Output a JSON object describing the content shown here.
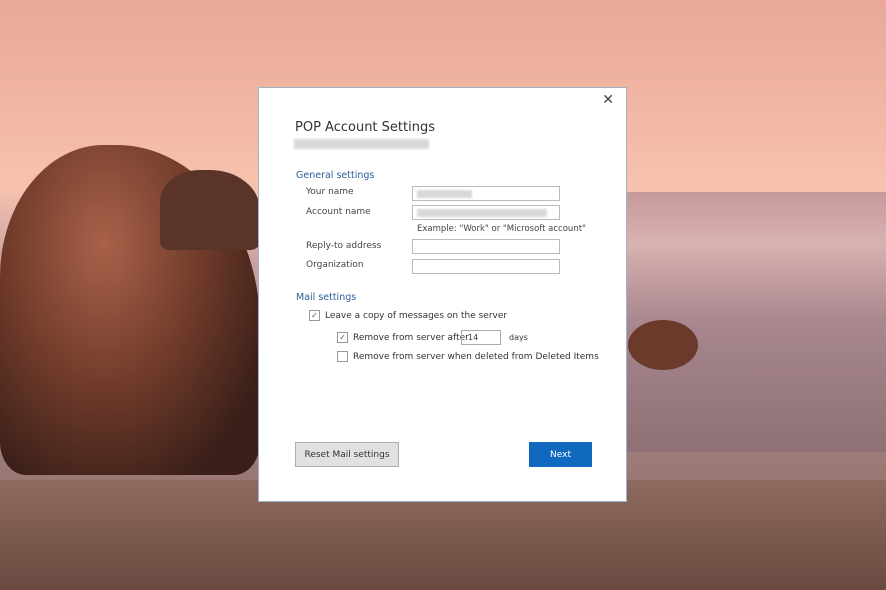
{
  "dialog": {
    "title": "POP Account Settings",
    "close": "✕",
    "general_settings": "General settings",
    "your_name_label": "Your name",
    "account_name_label": "Account name",
    "account_hint": "Example: \"Work\" or \"Microsoft account\"",
    "reply_to_label": "Reply-to address",
    "organization_label": "Organization",
    "mail_settings": "Mail settings",
    "leave_copy": {
      "label": "Leave a copy of messages on the server",
      "checked": true
    },
    "remove_after": {
      "label": "Remove from server after",
      "checked": true,
      "value": "14",
      "unit": "days"
    },
    "remove_deleted": {
      "label": "Remove from server when deleted from Deleted Items",
      "checked": false
    },
    "reset_button": "Reset Mail settings",
    "next_button": "Next",
    "accent": "#1068bf"
  }
}
